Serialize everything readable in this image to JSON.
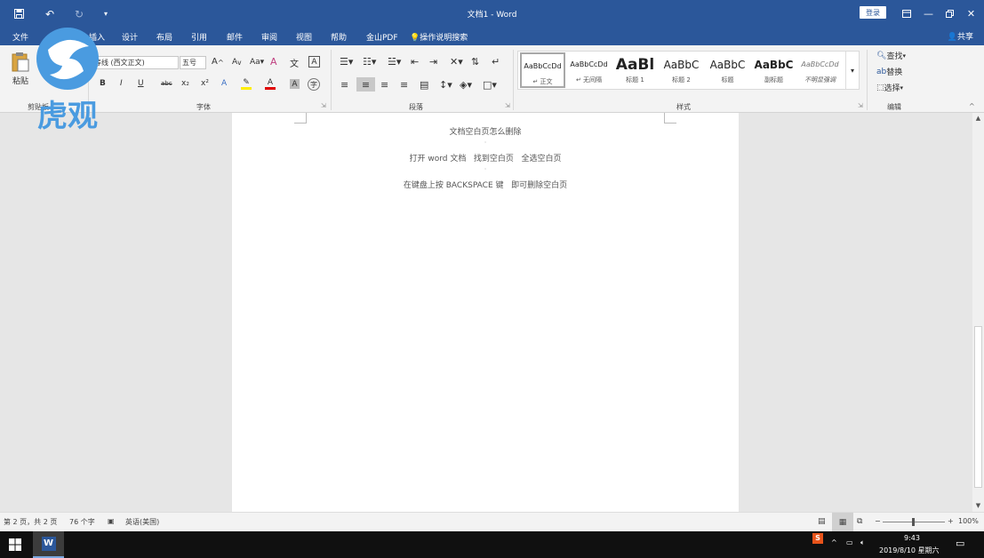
{
  "window": {
    "title": "文档1 - Word",
    "login_label": "登录",
    "qa_icons": [
      "save-icon",
      "undo-icon",
      "redo-icon",
      "customize-qa-icon"
    ]
  },
  "tabs": [
    "文件",
    "开始",
    "插入",
    "设计",
    "布局",
    "引用",
    "邮件",
    "审阅",
    "视图",
    "帮助",
    "金山PDF"
  ],
  "tell_me": "操作说明搜索",
  "share_label": "共享",
  "ribbon": {
    "clipboard": {
      "paste_label": "粘贴",
      "group_label": "剪贴板"
    },
    "font": {
      "font_name": "等线 (西文正文)",
      "font_size": "五号",
      "group_label": "字体",
      "buttons": [
        "B",
        "I",
        "U",
        "abc",
        "x₂",
        "x²",
        "A",
        "A",
        "A"
      ]
    },
    "paragraph": {
      "group_label": "段落"
    },
    "styles": {
      "group_label": "样式",
      "items": [
        {
          "preview": "AaBbCcDd",
          "name": "↵ 正文"
        },
        {
          "preview": "AaBbCcDd",
          "name": "↵ 无间隔"
        },
        {
          "preview": "AaBl",
          "name": "标题 1"
        },
        {
          "preview": "AaBbC",
          "name": "标题 2"
        },
        {
          "preview": "AaBbC",
          "name": "标题"
        },
        {
          "preview": "AaBbC",
          "name": "副标题"
        },
        {
          "preview": "AaBbCcDd",
          "name": "不明显强调"
        }
      ]
    },
    "editing": {
      "find": "查找",
      "replace": "替换",
      "select": "选择",
      "group_label": "编辑"
    }
  },
  "document": {
    "paragraphs": [
      "文档空白页怎么删除",
      "打开 word 文档   找到空白页   全选空白页",
      "在键盘上按 BACKSPACE 键   即可删除空白页"
    ]
  },
  "statusbar": {
    "page": "第 2 页，共 2 页",
    "words": "76 个字",
    "language": "英语(美国)",
    "zoom": "100%"
  },
  "taskbar": {
    "time": "9:43",
    "date": "2019/8/10 星期六",
    "input_method": "S"
  },
  "watermark": {
    "text": "虎观"
  }
}
